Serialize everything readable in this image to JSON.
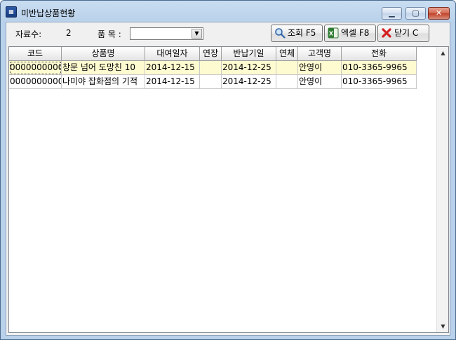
{
  "window": {
    "title": "미반납상품현황",
    "icon_name": "app-icon"
  },
  "filters": {
    "count_label": "자료수:",
    "count_value": "2",
    "item_label": "품 목 :",
    "item_value": ""
  },
  "toolbar": {
    "search_label": "조회 F5",
    "excel_label": "엑셀 F8",
    "close_label": "닫기 C"
  },
  "grid": {
    "columns": [
      "코드",
      "상품명",
      "대여일자",
      "연장",
      "반납기일",
      "연체",
      "고객명",
      "전화"
    ],
    "rows": [
      [
        "0000000000",
        "창문 넘어 도망친 10",
        "2014-12-15",
        "",
        "2014-12-25",
        "",
        "안영이",
        "010-3365-9965"
      ],
      [
        "0000000000",
        "나미야 잡화점의 기적",
        "2014-12-15",
        "",
        "2014-12-25",
        "",
        "안영이",
        "010-3365-9965"
      ]
    ],
    "selected_row": 0
  }
}
